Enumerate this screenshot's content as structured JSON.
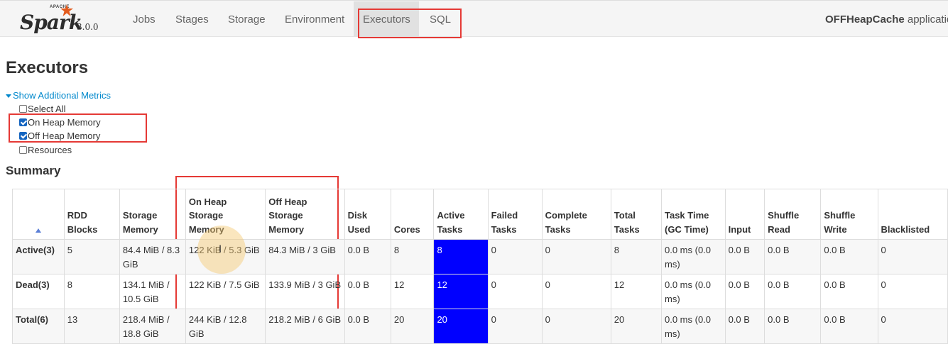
{
  "navbar": {
    "brand_top": "APACHE",
    "brand_name": "Spark",
    "version": "3.0.0",
    "items": [
      "Jobs",
      "Stages",
      "Storage",
      "Environment",
      "Executors",
      "SQL"
    ],
    "active_item": "Executors",
    "app_name": "OFFHeapCache",
    "app_suffix": " applicatio"
  },
  "page": {
    "title": "Executors",
    "metrics_link": "Show Additional Metrics",
    "checkboxes": [
      {
        "label": "Select All",
        "checked": false
      },
      {
        "label": "On Heap Memory",
        "checked": true
      },
      {
        "label": "Off Heap Memory",
        "checked": true
      },
      {
        "label": "Resources",
        "checked": false
      }
    ],
    "summary_heading": "Summary"
  },
  "table": {
    "headers": [
      [
        "",
        ""
      ],
      [
        "RDD",
        "Blocks"
      ],
      [
        "Storage",
        "Memory"
      ],
      [
        "On Heap",
        "Storage",
        "Memory"
      ],
      [
        "Off Heap",
        "Storage",
        "Memory"
      ],
      [
        "Disk",
        "Used"
      ],
      [
        "Cores"
      ],
      [
        "Active",
        "Tasks"
      ],
      [
        "Failed",
        "Tasks"
      ],
      [
        "Complete",
        "Tasks"
      ],
      [
        "Total",
        "Tasks"
      ],
      [
        "Task Time",
        "(GC Time)"
      ],
      [
        "Input"
      ],
      [
        "Shuffle",
        "Read"
      ],
      [
        "Shuffle",
        "Write"
      ],
      [
        "Blacklisted"
      ]
    ],
    "rows": [
      [
        "Active(3)",
        "5",
        "84.4 MiB / 8.3 GiB",
        "122 KiB / 5.3 GiB",
        "84.3 MiB / 3 GiB",
        "0.0 B",
        "8",
        "8",
        "0",
        "0",
        "8",
        "0.0 ms (0.0 ms)",
        "0.0 B",
        "0.0 B",
        "0.0 B",
        "0"
      ],
      [
        "Dead(3)",
        "8",
        "134.1 MiB / 10.5 GiB",
        "122 KiB / 7.5 GiB",
        "133.9 MiB / 3 GiB",
        "0.0 B",
        "12",
        "12",
        "0",
        "0",
        "12",
        "0.0 ms (0.0 ms)",
        "0.0 B",
        "0.0 B",
        "0.0 B",
        "0"
      ],
      [
        "Total(6)",
        "13",
        "218.4 MiB / 18.8 GiB",
        "244 KiB / 12.8 GiB",
        "218.2 MiB / 6 GiB",
        "0.0 B",
        "20",
        "20",
        "0",
        "0",
        "20",
        "0.0 ms (0.0 ms)",
        "0.0 B",
        "0.0 B",
        "0.0 B",
        "0"
      ]
    ]
  },
  "colors": {
    "active_tasks_bg": "#0000ff",
    "annotation_red": "#e53935",
    "link_blue": "#0088cc"
  }
}
